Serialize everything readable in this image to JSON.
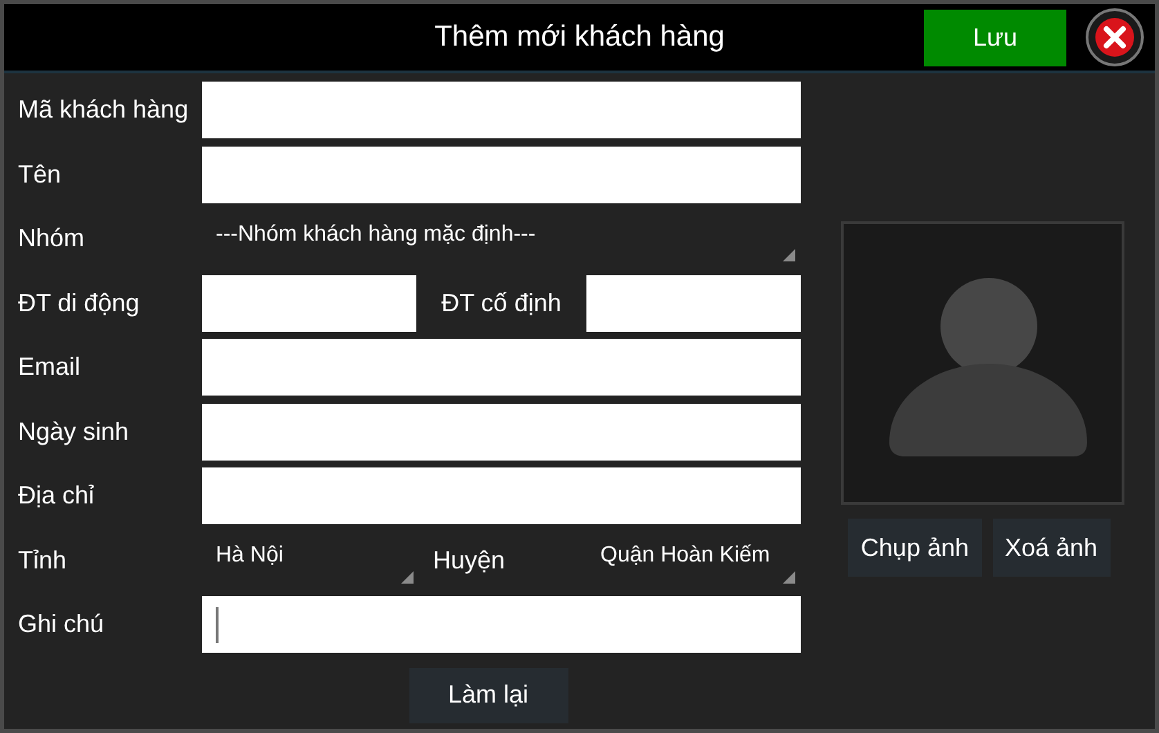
{
  "header": {
    "title": "Thêm mới khách hàng",
    "save_button": "Lưu"
  },
  "fields": [
    {
      "kind": "text",
      "label": "Mã khách hàng",
      "focused": false
    },
    {
      "kind": "text",
      "label": "Tên",
      "focused": false
    },
    {
      "kind": "select",
      "label": "Nhóm",
      "value": "---Nhóm khách hàng mặc định---"
    },
    {
      "kind": "pair",
      "label": "ĐT di động",
      "label_2": "ĐT cố định"
    },
    {
      "kind": "text",
      "label": "Email",
      "focused": false
    },
    {
      "kind": "text",
      "label": "Ngày sinh",
      "focused": false
    },
    {
      "kind": "text",
      "label": "Địa chỉ",
      "focused": false
    },
    {
      "kind": "select_pair",
      "label": "Tỉnh",
      "value": "Hà Nội",
      "label_2": "Huyện",
      "value_2": "Quận Hoàn Kiếm"
    },
    {
      "kind": "text",
      "label": "Ghi chú",
      "focused": true
    }
  ],
  "photo": {
    "buttons": [
      "Chụp ảnh",
      "Xoá ảnh"
    ]
  },
  "reset_button": "Làm lại"
}
